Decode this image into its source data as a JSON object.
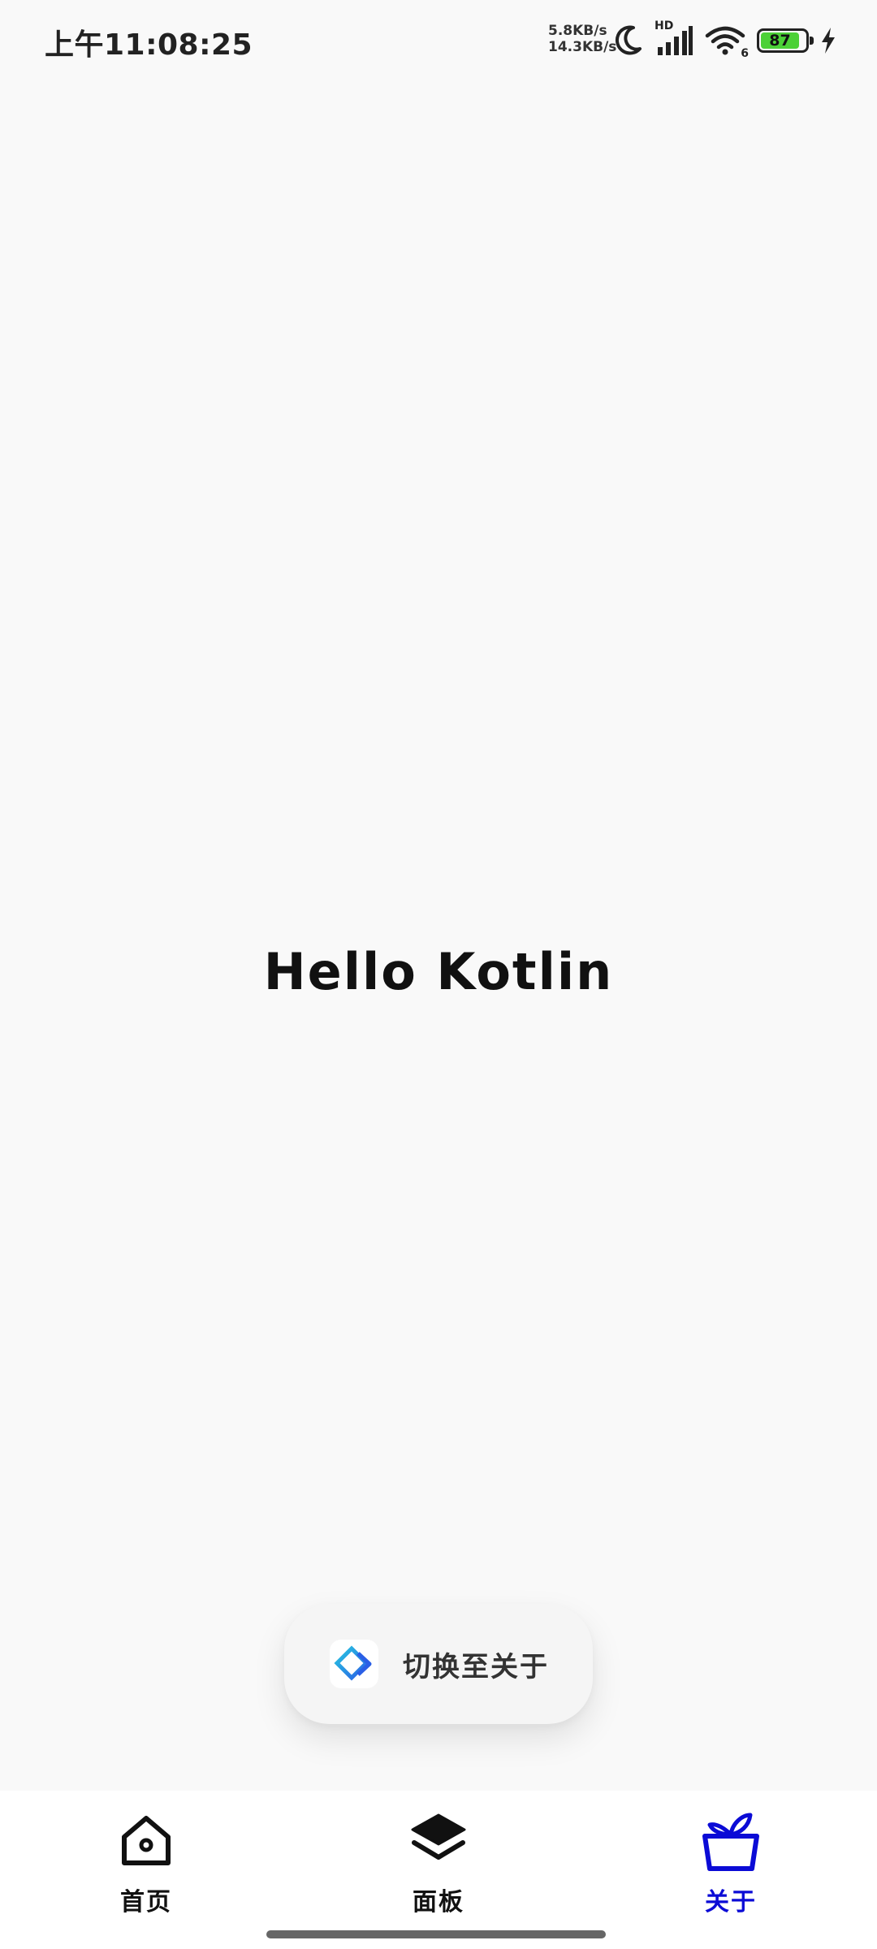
{
  "status_bar": {
    "time": "上午11:08:25",
    "net_up": "5.8KB/s",
    "net_down": "14.3KB/s",
    "signal_label": "HD",
    "wifi_label": "6",
    "battery_level": "87",
    "battery_fraction": 0.87,
    "battery_color": "#4cd137",
    "icons": [
      "moon-icon",
      "cellular-signal-icon",
      "wifi-icon",
      "battery-icon",
      "charging-bolt-icon"
    ]
  },
  "main": {
    "text": "Hello Kotlin"
  },
  "switch_pill": {
    "label": "切换至关于",
    "icon": "app-logo-icon"
  },
  "bottom_nav": {
    "active_color": "#0b0bd6",
    "items": [
      {
        "label": "首页",
        "icon": "home-icon",
        "active": false
      },
      {
        "label": "面板",
        "icon": "layers-icon",
        "active": false
      },
      {
        "label": "关于",
        "icon": "plant-pot-icon",
        "active": true
      }
    ]
  }
}
